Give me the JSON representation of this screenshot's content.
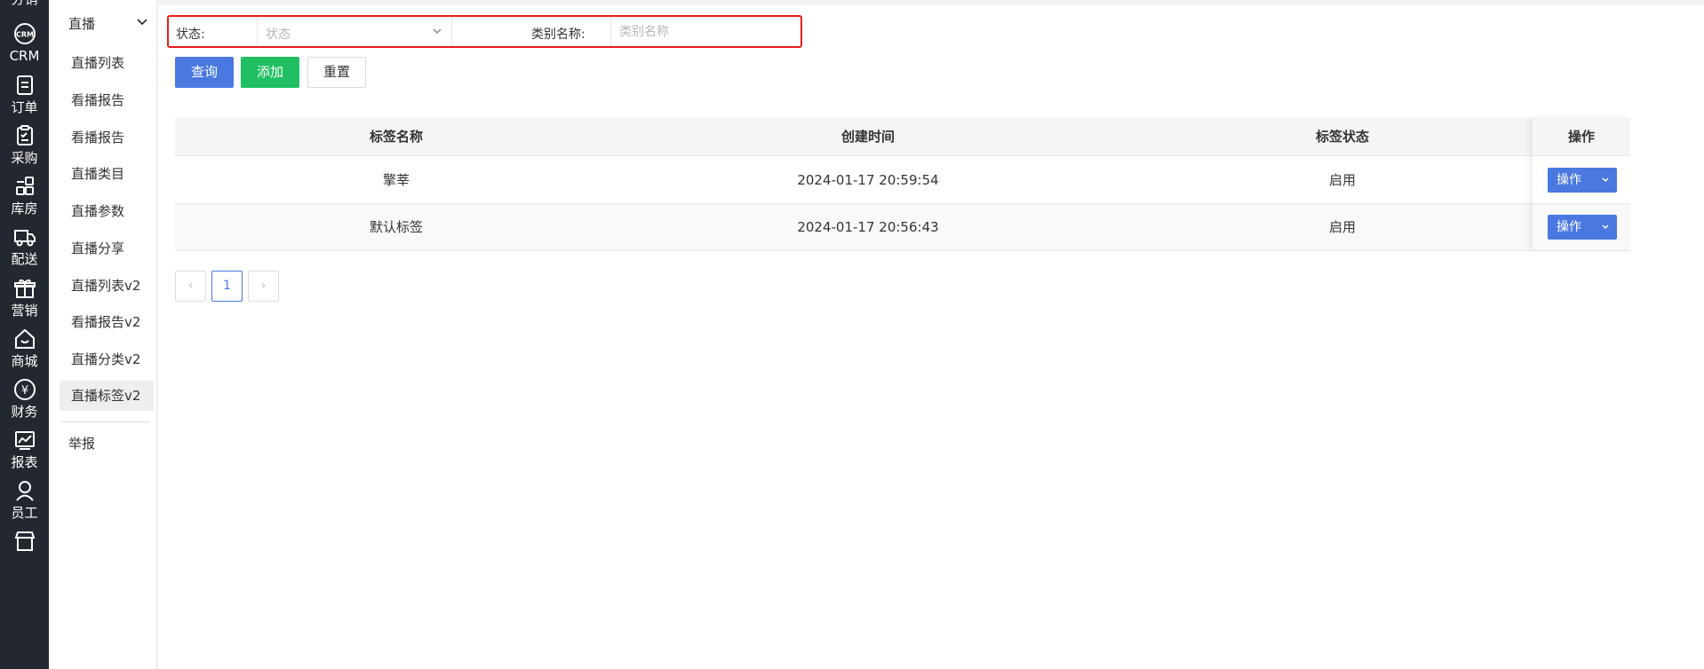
{
  "rail": {
    "items": [
      {
        "label": "分销",
        "icon": "share-icon"
      },
      {
        "label": "CRM",
        "icon": "crm-icon"
      },
      {
        "label": "订单",
        "icon": "order-icon"
      },
      {
        "label": "采购",
        "icon": "clipboard-icon"
      },
      {
        "label": "库房",
        "icon": "grid-icon"
      },
      {
        "label": "配送",
        "icon": "truck-icon"
      },
      {
        "label": "营销",
        "icon": "gift-icon"
      },
      {
        "label": "商城",
        "icon": "home-icon"
      },
      {
        "label": "财务",
        "icon": "yen-icon"
      },
      {
        "label": "报表",
        "icon": "chart-icon"
      },
      {
        "label": "员工",
        "icon": "user-icon"
      },
      {
        "label": "",
        "icon": "store-icon"
      }
    ],
    "crm_badge": "CRM"
  },
  "submenu": {
    "header": "直播",
    "items": [
      {
        "label": "直播列表"
      },
      {
        "label": "看播报告"
      },
      {
        "label": "看播报告"
      },
      {
        "label": "直播类目"
      },
      {
        "label": "直播参数"
      },
      {
        "label": "直播分享"
      },
      {
        "label": "直播列表v2"
      },
      {
        "label": "看播报告v2"
      },
      {
        "label": "直播分类v2"
      },
      {
        "label": "直播标签v2"
      }
    ],
    "report": "举报"
  },
  "filter": {
    "status_label": "状态:",
    "status_placeholder": "状态",
    "category_label": "类别名称:",
    "category_placeholder": "类别名称"
  },
  "buttons": {
    "query": "查询",
    "add": "添加",
    "reset": "重置"
  },
  "table": {
    "headers": [
      "标签名称",
      "创建时间",
      "标签状态",
      "操作"
    ],
    "rows": [
      {
        "name": "擎莘",
        "created": "2024-01-17 20:59:54",
        "status": "启用",
        "action": "操作"
      },
      {
        "name": "默认标签",
        "created": "2024-01-17 20:56:43",
        "status": "启用",
        "action": "操作"
      }
    ]
  },
  "pagination": {
    "prev": "‹",
    "current": "1",
    "next": "›"
  }
}
